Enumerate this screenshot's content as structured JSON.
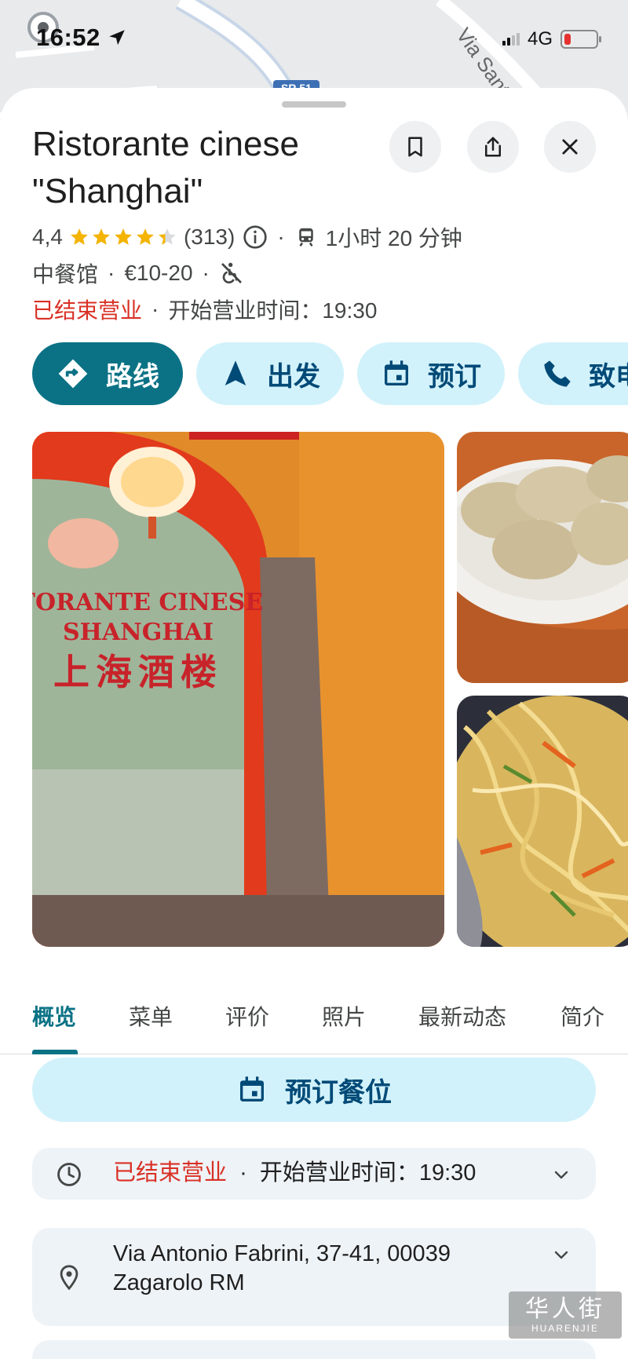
{
  "status_bar": {
    "time": "16:52",
    "network": "4G",
    "battery_level": 0.2
  },
  "map": {
    "street_label": "Via Santa Maria",
    "road_badge": "SR 51"
  },
  "place": {
    "title": "Ristorante cinese \"Shanghai\"",
    "rating": "4,4",
    "rating_value": 4.4,
    "review_count": "(313)",
    "transit_time": "1小时 20 分钟",
    "category": "中餐馆",
    "price": "€10-20",
    "status_closed": "已结束营业",
    "opens_text": "开始营业时间：19:30"
  },
  "actions": [
    {
      "label": "路线",
      "icon": "directions-icon"
    },
    {
      "label": "出发",
      "icon": "navigation-arrow-icon"
    },
    {
      "label": "预订",
      "icon": "calendar-icon"
    },
    {
      "label": "致电",
      "icon": "phone-icon"
    }
  ],
  "photos": {
    "sign_line1": "STORANTE CINESE",
    "sign_line2": "SHANGHAI",
    "sign_line3": "上海酒楼"
  },
  "tabs": [
    "概览",
    "菜单",
    "评价",
    "照片",
    "最新动态",
    "简介"
  ],
  "active_tab": "概览",
  "reserve_button": "预订餐位",
  "hours_row": {
    "closed": "已结束营业",
    "opens": "开始营业时间：19:30"
  },
  "address_row": {
    "line1": "Via Antonio Fabrini, 37-41, 00039",
    "line2": "Zagarolo RM"
  },
  "watermark": {
    "chinese": "华人街",
    "latin": "HUARENJIE"
  },
  "colors": {
    "accent": "#0b7285",
    "chip_bg": "#d2f2fb",
    "closed_red": "#d93025",
    "star": "#f4b400"
  }
}
